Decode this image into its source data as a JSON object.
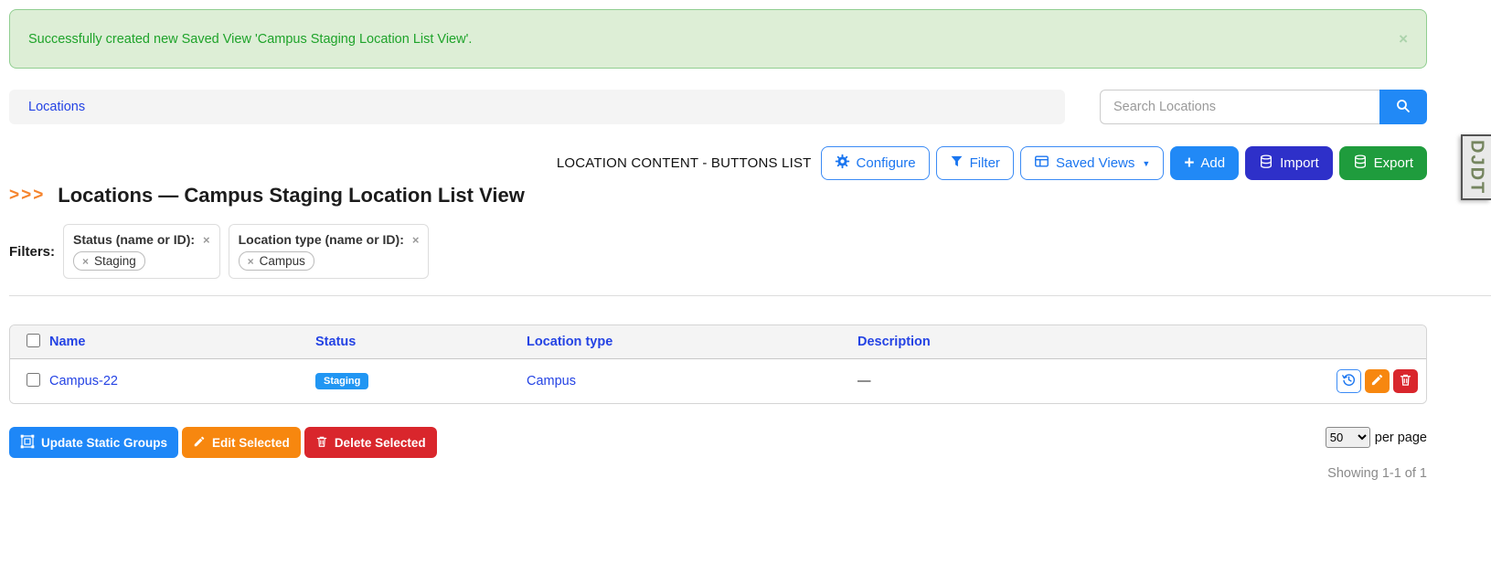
{
  "alert": {
    "message": "Successfully created new Saved View 'Campus Staging Location List View'.",
    "close": "×"
  },
  "breadcrumb": {
    "locations": "Locations"
  },
  "search": {
    "placeholder": "Search Locations"
  },
  "toolbar": {
    "context_label": "LOCATION CONTENT - BUTTONS LIST",
    "configure": "Configure",
    "filter": "Filter",
    "saved_views": "Saved Views",
    "add": "Add",
    "import": "Import",
    "export": "Export"
  },
  "debug": {
    "handle": "DJDT"
  },
  "page": {
    "chevrons": ">>>",
    "title": "Locations — Campus Staging Location List View"
  },
  "filters": {
    "label": "Filters:",
    "groups": [
      {
        "field": "Status (name or ID):",
        "remove": "×",
        "chip_remove": "×",
        "chip": "Staging"
      },
      {
        "field": "Location type (name or ID):",
        "remove": "×",
        "chip_remove": "×",
        "chip": "Campus"
      }
    ]
  },
  "table": {
    "headers": {
      "name": "Name",
      "status": "Status",
      "location_type": "Location type",
      "description": "Description"
    },
    "rows": [
      {
        "name": "Campus-22",
        "status": "Staging",
        "location_type": "Campus",
        "description": "—"
      }
    ]
  },
  "bulk": {
    "update_static_groups": "Update Static Groups",
    "edit_selected": "Edit Selected",
    "delete_selected": "Delete Selected"
  },
  "pagination": {
    "per_page": "50",
    "per_page_label": "per page",
    "showing": "Showing 1-1 of 1"
  },
  "colors": {
    "accent_blue": "#1b76f0",
    "link_blue": "#2443e4",
    "add_blue": "#2189f6",
    "import_indigo": "#2e30c9",
    "export_green": "#1f9c3d",
    "badge_blue": "#2196f3",
    "edit_orange": "#f7870f",
    "delete_red": "#d9262c",
    "success_green": "#1ea32a",
    "alert_bg": "#ddeed6"
  }
}
